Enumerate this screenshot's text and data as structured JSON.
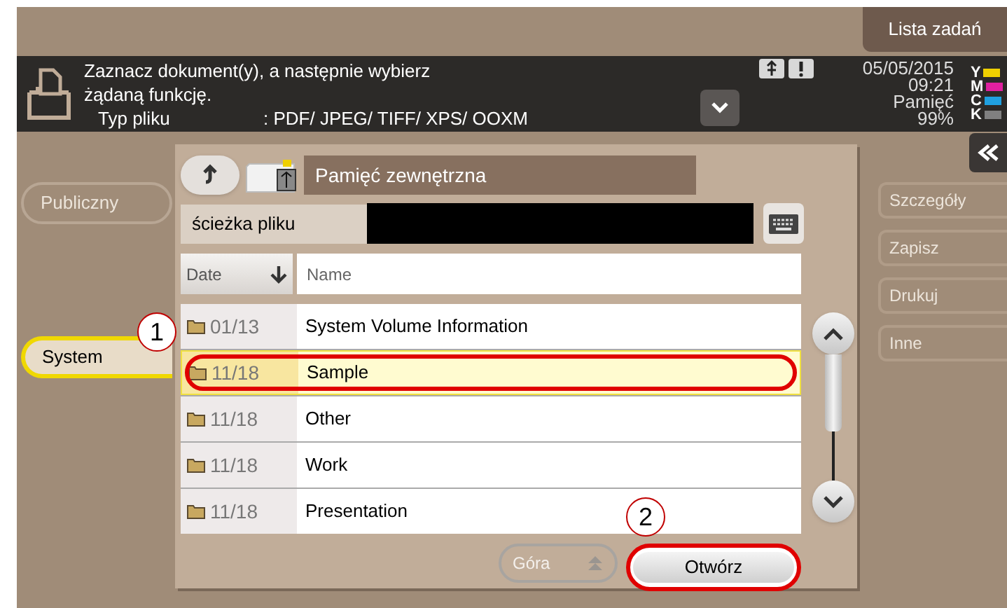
{
  "job_list_tab": {
    "label": "Lista zadań"
  },
  "info_bar": {
    "message": "Zaznacz dokument(y), a następnie wybierz żądaną funkcję.",
    "file_type_label": "Typ pliku",
    "file_type_value": ": PDF/ JPEG/ TIFF/ XPS/ OOXM",
    "date": "05/05/2015",
    "time": "09:21",
    "memory_label": "Pamięć",
    "memory_value": "99%",
    "toner": [
      {
        "letter": "Y",
        "color": "#f0d000"
      },
      {
        "letter": "M",
        "color": "#e020a0"
      },
      {
        "letter": "C",
        "color": "#20a0e0"
      },
      {
        "letter": "K",
        "color": "#808080"
      }
    ]
  },
  "left_buttons": [
    {
      "label": "Publiczny",
      "selected": false,
      "disabled": true
    },
    {
      "label": "System",
      "selected": true,
      "disabled": false
    }
  ],
  "panel": {
    "title": "Pamięć zewnętrzna",
    "path_label": "ścieżka pliku",
    "sort_label": "Date",
    "name_label": "Name",
    "rows": [
      {
        "date": "01/13",
        "name": "System Volume Information",
        "selected": false
      },
      {
        "date": "11/18",
        "name": "Sample",
        "selected": true,
        "callout": "1"
      },
      {
        "date": "11/18",
        "name": "Other",
        "selected": false
      },
      {
        "date": "11/18",
        "name": "Work",
        "selected": false
      },
      {
        "date": "11/18",
        "name": "Presentation",
        "selected": false
      }
    ],
    "top_button": {
      "label": "Góra",
      "disabled": true
    },
    "open_button": {
      "label": "Otwórz",
      "disabled": false,
      "callout": "2"
    }
  },
  "right_buttons": [
    {
      "label": "Szczegóły",
      "disabled": true
    },
    {
      "label": "Zapisz",
      "disabled": true
    },
    {
      "label": "Drukuj",
      "disabled": true
    },
    {
      "label": "Inne",
      "disabled": true
    }
  ]
}
